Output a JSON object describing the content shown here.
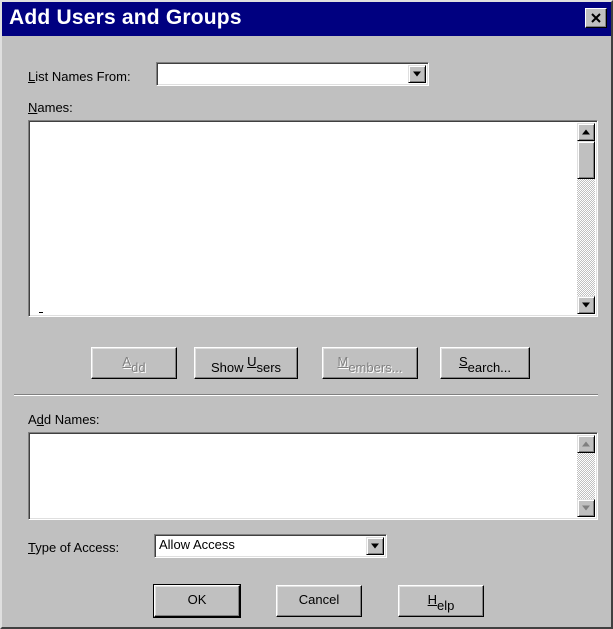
{
  "window": {
    "title": "Add Users and Groups",
    "close_icon": "close-x-icon"
  },
  "list_names_from": {
    "label_mnemonic": "L",
    "label_rest": "ist Names From:",
    "value": ""
  },
  "names": {
    "label_mnemonic": "N",
    "label_rest": "ames:"
  },
  "action_buttons": {
    "add": {
      "pre": "",
      "mn": "A",
      "post": "dd",
      "enabled": false
    },
    "show_users": {
      "pre": "Show ",
      "mn": "U",
      "post": "sers",
      "enabled": true
    },
    "members": {
      "pre": "",
      "mn": "M",
      "post": "embers...",
      "enabled": false
    },
    "search": {
      "pre": "",
      "mn": "S",
      "post": "earch...",
      "enabled": true
    }
  },
  "add_names": {
    "label_pre": "A",
    "label_mnemonic": "d",
    "label_rest": "d Names:"
  },
  "type_of_access": {
    "label_mnemonic": "T",
    "label_rest": "ype of Access:",
    "value": "Allow Access"
  },
  "dialog_buttons": {
    "ok": "OK",
    "cancel": "Cancel",
    "help_mn": "H",
    "help_rest": "elp"
  },
  "colors": {
    "title_bar": "#000080",
    "face": "#c0c0c0"
  }
}
